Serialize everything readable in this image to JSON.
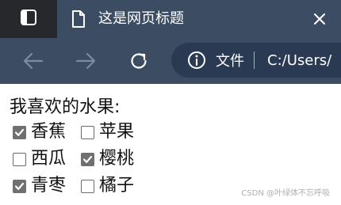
{
  "browser": {
    "tab": {
      "title": "这是网页标题"
    },
    "address": {
      "site_label": "文件",
      "url": "C:/Users/"
    }
  },
  "page": {
    "heading": "我喜欢的水果:",
    "fruits": [
      {
        "label": "香蕉",
        "checked": true
      },
      {
        "label": "苹果",
        "checked": false
      },
      {
        "label": "西瓜",
        "checked": false
      },
      {
        "label": "樱桃",
        "checked": true
      },
      {
        "label": "青枣",
        "checked": true
      },
      {
        "label": "橘子",
        "checked": false
      }
    ]
  },
  "watermark": "CSDN @叶绿体不忘呼吸",
  "colors": {
    "tabstrip": "#2b2c30",
    "toolbar": "#3c4c63",
    "omnibox": "#2a3a52",
    "checkbox_checked": "#707070"
  }
}
